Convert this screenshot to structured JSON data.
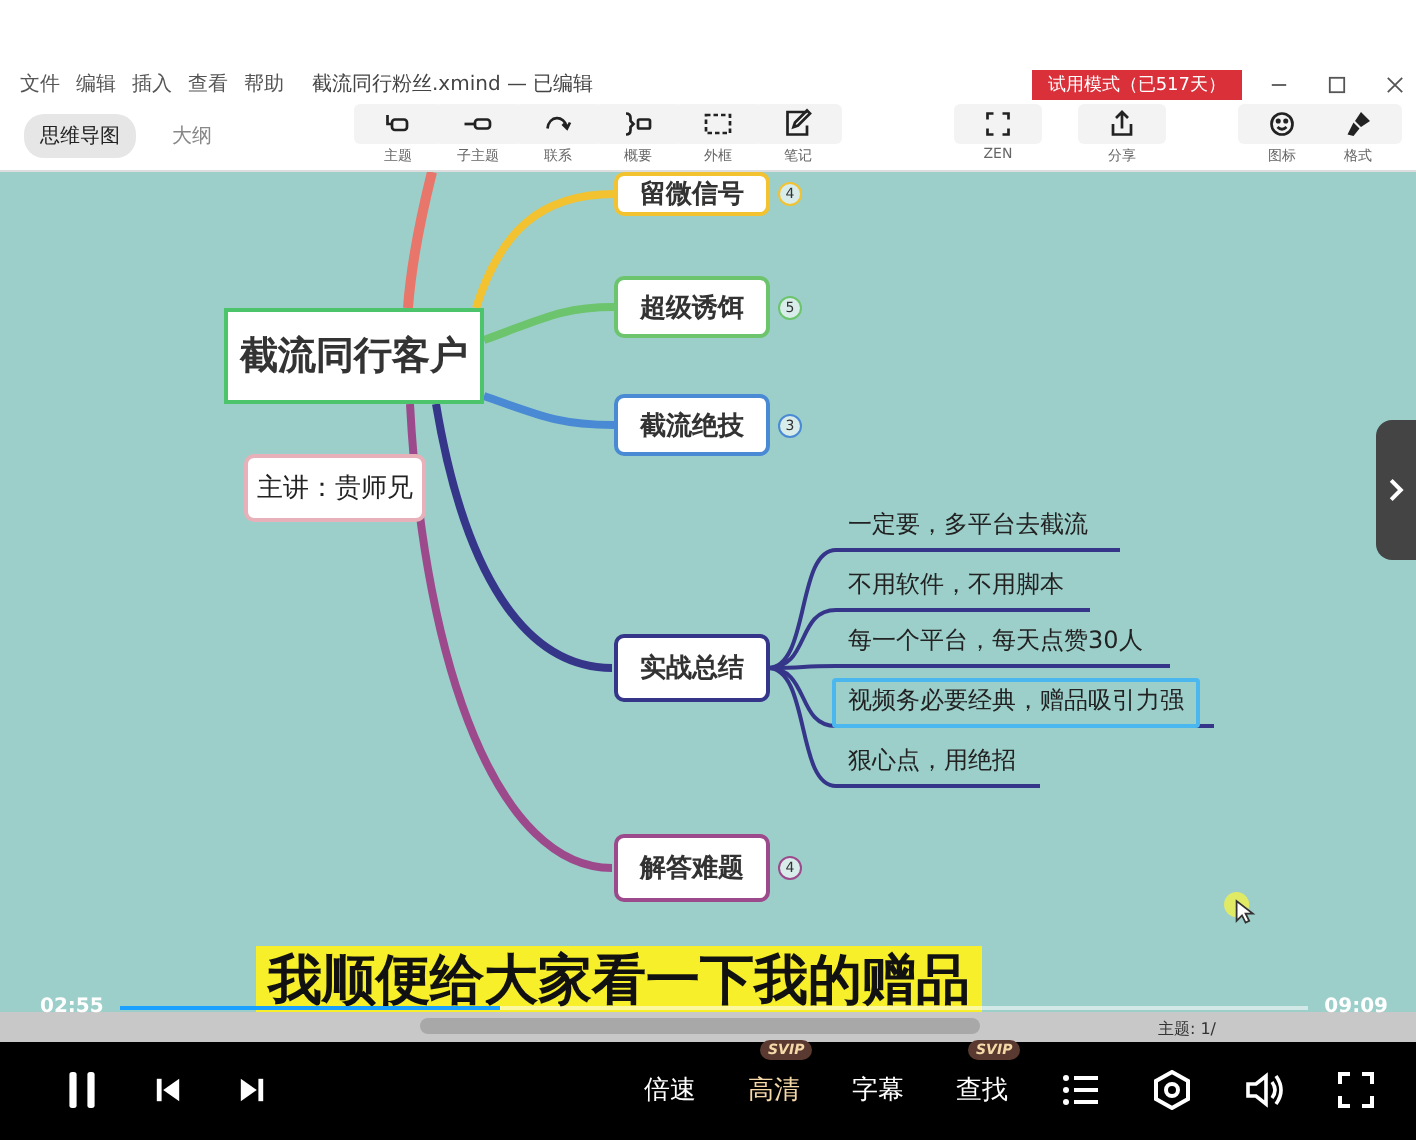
{
  "xmind": {
    "menu": [
      "文件",
      "编辑",
      "插入",
      "查看",
      "帮助"
    ],
    "file_title": "截流同行粉丝.xmind — 已编辑",
    "trial_badge": "试用模式（已517天）",
    "view_tabs": [
      {
        "label": "思维导图",
        "selected": true
      },
      {
        "label": "大纲",
        "selected": false
      }
    ],
    "tools": [
      {
        "label": "主题"
      },
      {
        "label": "子主题"
      },
      {
        "label": "联系"
      },
      {
        "label": "概要"
      },
      {
        "label": "外框"
      },
      {
        "label": "笔记"
      }
    ],
    "view_tools": [
      {
        "label": "ZEN"
      },
      {
        "label": "分享"
      }
    ],
    "panel_tools": [
      {
        "label": "图标"
      },
      {
        "label": "格式"
      }
    ],
    "status_text": "主题: 1/"
  },
  "mindmap": {
    "root": "截流同行客户",
    "speaker": "主讲：贵师兄",
    "branches": [
      {
        "label": "留微信号",
        "color": "#f2c230",
        "count": "4"
      },
      {
        "label": "超级诱饵",
        "color": "#6cc46c",
        "count": "5"
      },
      {
        "label": "截流绝技",
        "color": "#4a8ad4",
        "count": "3"
      },
      {
        "label": "实战总结",
        "color": "#35358a",
        "children": [
          {
            "label": "一定要，多平台去截流",
            "selected": false
          },
          {
            "label": "不用软件，不用脚本",
            "selected": false
          },
          {
            "label": "每一个平台，每天点赞30人",
            "selected": false
          },
          {
            "label": "视频务必要经典，赠品吸引力强",
            "selected": true
          },
          {
            "label": "狠心点，用绝招",
            "selected": false
          }
        ]
      },
      {
        "label": "解答难题",
        "color": "#9c4a8c",
        "count": "4"
      }
    ]
  },
  "player": {
    "subtitle": "我顺便给大家看一下我的赠品",
    "elapsed": "02:55",
    "duration": "09:09",
    "progress": {
      "level": 0.32
    },
    "options": [
      {
        "label": "倍速",
        "selected": false
      },
      {
        "label": "高清",
        "selected": true,
        "badge": "SVIP"
      },
      {
        "label": "字幕",
        "selected": false
      },
      {
        "label": "查找",
        "selected": false,
        "badge": "SVIP"
      }
    ]
  }
}
